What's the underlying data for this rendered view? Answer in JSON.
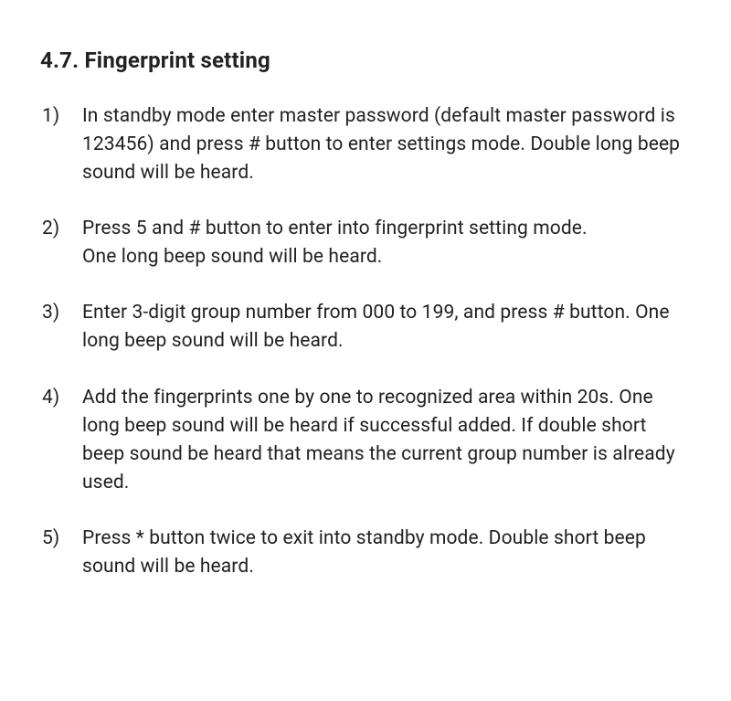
{
  "section": {
    "number": "4.7.",
    "title": "Fingerprint setting"
  },
  "steps": [
    {
      "marker": "1)",
      "text": "In standby mode enter master password (default master password is 123456) and press # button to enter settings mode. Double long beep sound will be heard."
    },
    {
      "marker": "2)",
      "text": "Press 5 and # button to enter into fingerprint setting mode.\nOne long beep sound will be heard."
    },
    {
      "marker": "3)",
      "text": "Enter 3-digit group number from 000 to 199, and press # button. One long beep sound will be heard."
    },
    {
      "marker": "4)",
      "text": "Add the fingerprints one by one to recognized area within 20s. One long beep sound will be heard if successful added. If double short beep sound be heard that means the current group number is already used."
    },
    {
      "marker": "5)",
      "text": "Press * button twice to exit into standby mode. Double short beep sound will be heard."
    }
  ]
}
